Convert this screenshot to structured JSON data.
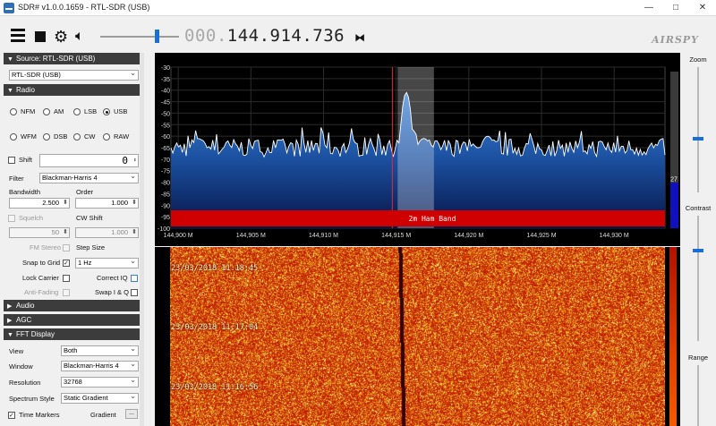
{
  "window": {
    "title": "SDR# v1.0.0.1659 - RTL-SDR (USB)",
    "minimize_glyph": "—",
    "maximize_glyph": "□",
    "close_glyph": "✕"
  },
  "toolbar": {
    "menu_icon": "menu-icon",
    "play_stop_icon": "stop-icon",
    "settings_icon": "gear-icon",
    "audio_icon": "speaker-icon",
    "volume": 0.72,
    "frequency_leading": "000.",
    "frequency_main": "144.914.736",
    "tuning_mode_icon": "bowtie-icon",
    "logo_text": "AIRSPY"
  },
  "source": {
    "header": "Source: RTL-SDR (USB)",
    "device": "RTL-SDR (USB)"
  },
  "radio": {
    "header": "Radio",
    "modes_row1": [
      "NFM",
      "AM",
      "LSB",
      "USB"
    ],
    "modes_row2": [
      "WFM",
      "DSB",
      "CW",
      "RAW"
    ],
    "selected_mode": "USB",
    "shift_label": "Shift",
    "shift_value": "0",
    "filter_label": "Filter",
    "filter_value": "Blackman-Harris 4",
    "bandwidth_label": "Bandwidth",
    "bandwidth_value": "2.500",
    "order_label": "Order",
    "order_value": "1.000",
    "squelch_label": "Squelch",
    "squelch_value": "50",
    "cw_shift_label": "CW Shift",
    "cw_shift_value": "1.000",
    "fm_stereo_label": "FM Stereo",
    "step_size_label": "Step Size",
    "snap_to_grid_label": "Snap to Grid",
    "snap_value": "1 Hz",
    "lock_carrier_label": "Lock Carrier",
    "correct_iq_label": "Correct IQ",
    "anti_fading_label": "Anti-Fading",
    "swap_iq_label": "Swap I & Q"
  },
  "audio": {
    "header": "Audio"
  },
  "agc": {
    "header": "AGC"
  },
  "fft": {
    "header": "FFT Display",
    "view_label": "View",
    "view_value": "Both",
    "window_label": "Window",
    "window_value": "Blackman-Harris 4",
    "resolution_label": "Resolution",
    "resolution_value": "32768",
    "spectrum_style_label": "Spectrum Style",
    "spectrum_style_value": "Static Gradient",
    "time_markers_label": "Time Markers",
    "gradient_label": "Gradient",
    "gradient_button": "..."
  },
  "right_panel": {
    "zoom_label": "Zoom",
    "contrast_label": "Contrast",
    "range_label": "Range"
  },
  "colors": {
    "spectrum_fill": "#1f5fb0",
    "band_bar": "#d10000",
    "waterfall_base": "#c81a00",
    "accent": "#1a6fd6"
  },
  "chart_data": {
    "type": "area",
    "ylim": [
      -100,
      -30
    ],
    "yticks": [
      "-30",
      "-35",
      "-40",
      "-45",
      "-50",
      "-55",
      "-60",
      "-65",
      "-70",
      "-75",
      "-80",
      "-85",
      "-90",
      "-95",
      "-100"
    ],
    "xlim": [
      144.8995,
      144.9335
    ],
    "xticks": [
      "144,900 M",
      "144,905 M",
      "144,910 M",
      "144,915 M",
      "144,920 M",
      "144,925 M",
      "144,930 M"
    ],
    "tuned_frequency_mhz": 144.914736,
    "filter_band_mhz": [
      144.9151,
      144.9176
    ],
    "noise_floor_db": -65,
    "noise_jitter_db": 4,
    "peaks": [
      {
        "x": 144.9157,
        "y": -41
      },
      {
        "x": 144.9169,
        "y": -61
      },
      {
        "x": 144.9014,
        "y": -61
      },
      {
        "x": 144.9213,
        "y": -60
      }
    ],
    "band_label": "2m Ham Band",
    "level_readout": "27",
    "level_fraction": 0.29,
    "waterfall_timestamps": [
      "23/03/2018 11:18:45",
      "23/03/2018 11:17:04",
      "23/03/2018 11:16:56"
    ]
  }
}
